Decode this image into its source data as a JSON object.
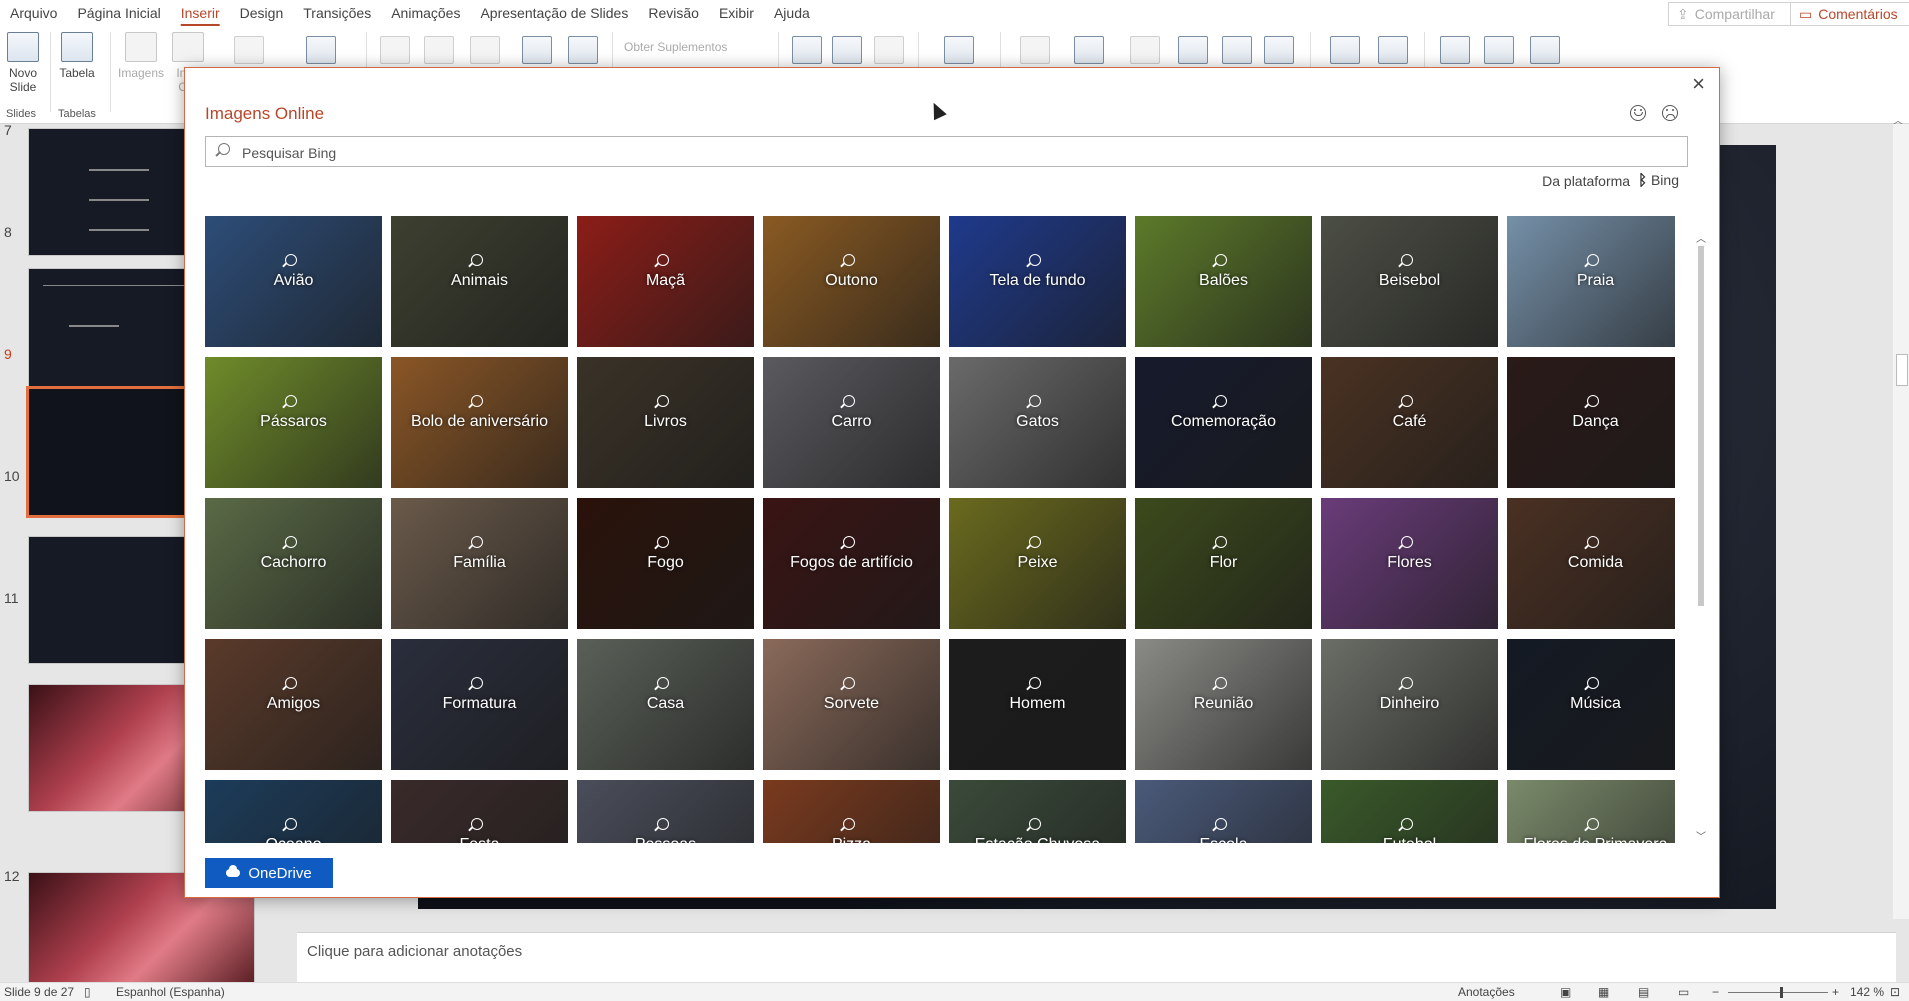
{
  "menu": {
    "items": [
      "Arquivo",
      "Página Inicial",
      "Inserir",
      "Design",
      "Transições",
      "Animações",
      "Apresentação de Slides",
      "Revisão",
      "Exibir",
      "Ajuda"
    ],
    "share_label": "Compartilhar",
    "comments_label": "Comentários"
  },
  "ribbon": {
    "new_slide_label": "Novo Slide",
    "table_label": "Tabela",
    "images_label": "Imagens",
    "images2_label": "Im... O...",
    "addins_label": "Obter Suplementos",
    "group_slides": "Slides",
    "group_tables": "Tabelas"
  },
  "slides": [
    {
      "num": "7"
    },
    {
      "num": "8"
    },
    {
      "num": "9"
    },
    {
      "num": "10"
    },
    {
      "num": "11"
    },
    {
      "num": "12"
    }
  ],
  "notes_placeholder": "Clique para adicionar anotações",
  "status": {
    "slide_counter": "Slide 9 de 27",
    "language": "Espanhol (Espanha)",
    "notes_label": "Anotações",
    "zoom": "142 %"
  },
  "dialog": {
    "title": "Imagens Online",
    "search_placeholder": "Pesquisar Bing",
    "provider_label": "Da plataforma",
    "provider_name": "Bing",
    "onedrive_label": "OneDrive",
    "tiles": [
      {
        "label": "Avião",
        "color": "#2d4d78"
      },
      {
        "label": "Animais",
        "color": "#3d4030"
      },
      {
        "label": "Maçã",
        "color": "#8c1d18"
      },
      {
        "label": "Outono",
        "color": "#8a5a22"
      },
      {
        "label": "Tela de fundo",
        "color": "#1f3a8c"
      },
      {
        "label": "Balões",
        "color": "#5c7a2a"
      },
      {
        "label": "Beisebol",
        "color": "#4c4f45"
      },
      {
        "label": "Praia",
        "color": "#7590a8"
      },
      {
        "label": "Pássaros",
        "color": "#6f8c2a"
      },
      {
        "label": "Bolo de aniversário",
        "color": "#8a5626"
      },
      {
        "label": "Livros",
        "color": "#3a3227"
      },
      {
        "label": "Carro",
        "color": "#5a5a5f"
      },
      {
        "label": "Gatos",
        "color": "#6a6a6a"
      },
      {
        "label": "Comemoração",
        "color": "#161a2c"
      },
      {
        "label": "Café",
        "color": "#4a3222"
      },
      {
        "label": "Dança",
        "color": "#2a1a18"
      },
      {
        "label": "Cachorro",
        "color": "#5a6a46"
      },
      {
        "label": "Família",
        "color": "#6a5a4a"
      },
      {
        "label": "Fogo",
        "color": "#2a120a"
      },
      {
        "label": "Fogos de artifício",
        "color": "#3a1414"
      },
      {
        "label": "Peixe",
        "color": "#6a6a1e"
      },
      {
        "label": "Flor",
        "color": "#3c4a1c"
      },
      {
        "label": "Flores",
        "color": "#6a3c7a"
      },
      {
        "label": "Comida",
        "color": "#4a3022"
      },
      {
        "label": "Amigos",
        "color": "#5a3a2a"
      },
      {
        "label": "Formatura",
        "color": "#2a2e3c"
      },
      {
        "label": "Casa",
        "color": "#5a6058"
      },
      {
        "label": "Sorvete",
        "color": "#8a6a5a"
      },
      {
        "label": "Homem",
        "color": "#1c1c1c"
      },
      {
        "label": "Reunião",
        "color": "#8a8a86"
      },
      {
        "label": "Dinheiro",
        "color": "#6a6e66"
      },
      {
        "label": "Música",
        "color": "#141a24"
      },
      {
        "label": "Oceano",
        "color": "#1c3c5a"
      },
      {
        "label": "Festa",
        "color": "#3a2a2a"
      },
      {
        "label": "Pessoas",
        "color": "#4a4e5a"
      },
      {
        "label": "Pizza",
        "color": "#7a3a1e"
      },
      {
        "label": "Estação Chuvosa",
        "color": "#3a4a3a"
      },
      {
        "label": "Escola",
        "color": "#4a5a7a"
      },
      {
        "label": "Futebol",
        "color": "#3a5a2a"
      },
      {
        "label": "Flores de Primavera",
        "color": "#7a8a6a"
      }
    ]
  }
}
